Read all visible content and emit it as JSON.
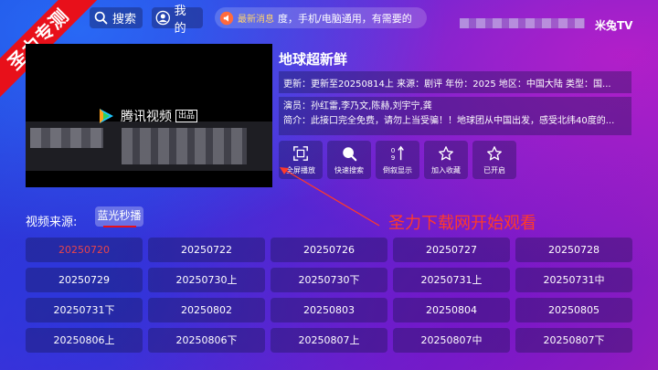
{
  "corner_ribbon": "圣力专测",
  "header": {
    "search_label": "搜索",
    "mine_label": "我的",
    "news_label": "最新消息",
    "news_text": "度，手机/电脑通用，有需要的",
    "brand": "米兔TV"
  },
  "player": {
    "logo_text": "腾讯视频",
    "logo_badge": "出品"
  },
  "show": {
    "title": "地球超新鲜",
    "meta": "更新：更新至20250814上  来源：剧评  年份：2025  地区：中国大陆  类型：国...",
    "actors": "演员：孙红雷,李乃文,陈赫,刘宇宁,龚",
    "summary": "简介：此接口完全免费，请勿上当受骗！！地球团从中国出发，感受北纬40度的..."
  },
  "actions": [
    {
      "icon": "fullscreen-icon",
      "label": "全屏播放"
    },
    {
      "icon": "search-icon",
      "label": "快速搜索"
    },
    {
      "icon": "sort-icon",
      "label": "倒叙显示"
    },
    {
      "icon": "star-icon",
      "label": "加入收藏"
    },
    {
      "icon": "star-icon",
      "label": "已开启"
    }
  ],
  "source": {
    "label": "视频来源:",
    "selected": "蓝光秒播"
  },
  "annotation": "圣力下载网开始观看",
  "episodes": [
    "20250720",
    "20250722",
    "20250726",
    "20250727",
    "20250728",
    "20250729",
    "20250730上",
    "20250730下",
    "20250731上",
    "20250731中",
    "20250731下",
    "20250802",
    "20250803",
    "20250804",
    "20250805",
    "20250806上",
    "20250806下",
    "20250807上",
    "20250807中",
    "20250807下"
  ],
  "active_episode_index": 0,
  "colors": {
    "accent_red": "#e8101a",
    "active_episode": "#e8454a",
    "annotation": "#ff3a2a"
  }
}
